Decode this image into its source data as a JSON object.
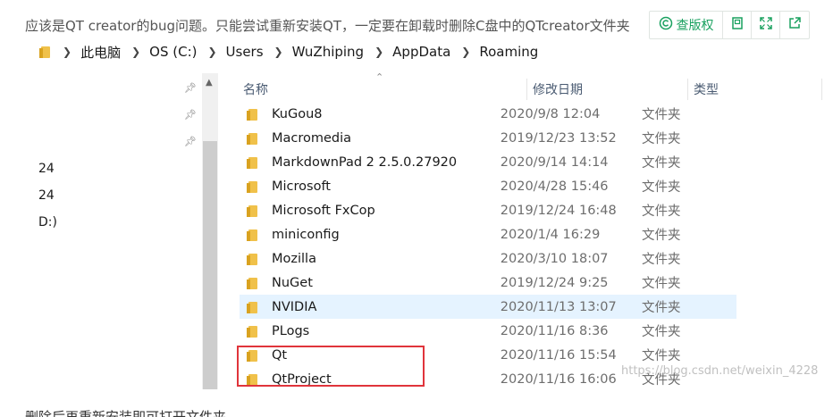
{
  "article": {
    "text": "应该是QT creator的bug问题。只能尝试重新安装QT，一定要在卸载时删除C盘中的QTcreator文件夹",
    "caption": "删除后再重新安装即可打开文件夹"
  },
  "toolbar": {
    "copyright_label": "查版权"
  },
  "breadcrumb": {
    "items": [
      "此电脑",
      "OS (C:)",
      "Users",
      "WuZhiping",
      "AppData",
      "Roaming"
    ]
  },
  "left_pane": {
    "items": [
      "24",
      "24",
      "D:)"
    ]
  },
  "columns": {
    "name": "名称",
    "date": "修改日期",
    "type": "类型"
  },
  "rows": [
    {
      "name": "KuGou8",
      "date": "2020/9/8 12:04",
      "type": "文件夹"
    },
    {
      "name": "Macromedia",
      "date": "2019/12/23 13:52",
      "type": "文件夹"
    },
    {
      "name": "MarkdownPad 2 2.5.0.27920",
      "date": "2020/9/14 14:14",
      "type": "文件夹"
    },
    {
      "name": "Microsoft",
      "date": "2020/4/28 15:46",
      "type": "文件夹"
    },
    {
      "name": "Microsoft FxCop",
      "date": "2019/12/24 16:48",
      "type": "文件夹"
    },
    {
      "name": "miniconfig",
      "date": "2020/1/4 16:29",
      "type": "文件夹"
    },
    {
      "name": "Mozilla",
      "date": "2020/3/10 18:07",
      "type": "文件夹"
    },
    {
      "name": "NuGet",
      "date": "2019/12/24 9:25",
      "type": "文件夹"
    },
    {
      "name": "NVIDIA",
      "date": "2020/11/13 13:07",
      "type": "文件夹"
    },
    {
      "name": "PLogs",
      "date": "2020/11/16 8:36",
      "type": "文件夹"
    },
    {
      "name": "Qt",
      "date": "2020/11/16 15:54",
      "type": "文件夹"
    },
    {
      "name": "QtProject",
      "date": "2020/11/16 16:06",
      "type": "文件夹"
    }
  ],
  "watermark": "https://blog.csdn.net/weixin_4228",
  "colors": {
    "accent_green": "#19a15f",
    "selection": "#e5f3ff",
    "highlight_red": "#e0343b",
    "folder": "#f0c14a"
  }
}
